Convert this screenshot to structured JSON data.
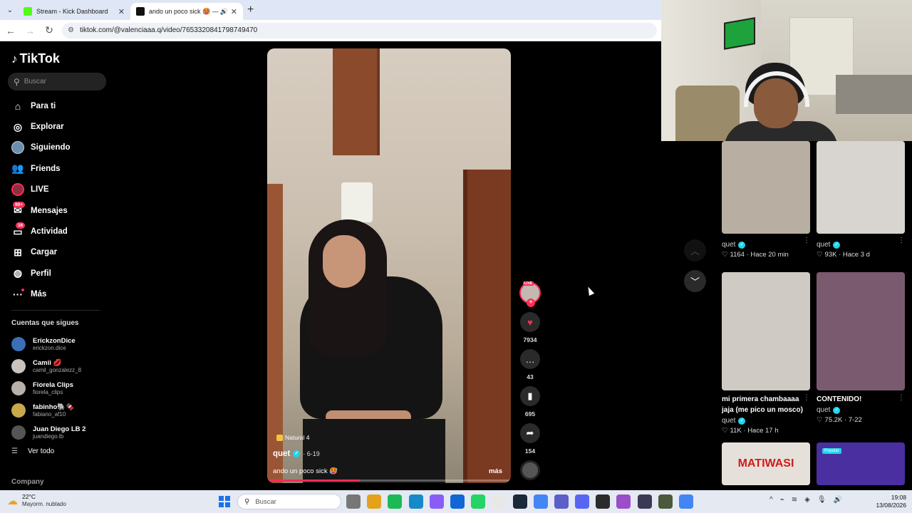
{
  "browser": {
    "tabs": [
      {
        "title": "Stream - Kick Dashboard",
        "favicon_color": "#53fc18",
        "active": false
      },
      {
        "title": "ando un poco sick 🥵 — q",
        "favicon_color": "#111111",
        "active": true
      }
    ],
    "url": "tiktok.com/@valenciaaa.q/video/7653320841798749470"
  },
  "sidebar": {
    "logo": "TikTok",
    "search_placeholder": "Buscar",
    "nav": [
      {
        "label": "Para ti",
        "icon": "home-icon",
        "glyph": "⌂"
      },
      {
        "label": "Explorar",
        "icon": "compass-icon",
        "glyph": "◎"
      },
      {
        "label": "Siguiendo",
        "icon": "following-avatar",
        "glyph": ""
      },
      {
        "label": "Friends",
        "icon": "friends-icon",
        "glyph": "👥"
      },
      {
        "label": "LIVE",
        "icon": "live-avatar",
        "glyph": ""
      },
      {
        "label": "Mensajes",
        "icon": "messages-icon",
        "glyph": "✉",
        "badge": "99+"
      },
      {
        "label": "Actividad",
        "icon": "activity-icon",
        "glyph": "▭",
        "badge": "16"
      },
      {
        "label": "Cargar",
        "icon": "upload-icon",
        "glyph": "⊞"
      },
      {
        "label": "Perfil",
        "icon": "profile-avatar",
        "glyph": "◍"
      },
      {
        "label": "Más",
        "icon": "more-icon",
        "glyph": "···"
      }
    ],
    "following_title": "Cuentas que sigues",
    "following": [
      {
        "name": "ErickzonDice",
        "handle": "erickzon.dice",
        "color": "#3b6fb6"
      },
      {
        "name": "Camii 💋",
        "handle": "camil_gonzalezz_8",
        "color": "#c9c2bd"
      },
      {
        "name": "Fiorela Clips",
        "handle": "fiorela_clips",
        "color": "#b8b0aa"
      },
      {
        "name": "fabinho🐘🍫",
        "handle": "fabiano_af10",
        "color": "#c8a84a"
      },
      {
        "name": "Juan Diego LB 2",
        "handle": "juandiego.lb",
        "color": "#555555"
      }
    ],
    "see_all": "Ver todo",
    "company": "Company"
  },
  "video": {
    "label": "Natural 4",
    "author": "quet",
    "date": "· 6-19",
    "caption": "ando un poco sick 🥵",
    "more": "más",
    "progress": 0.38,
    "likes": "7934",
    "comments": "43",
    "saves": "695",
    "shares": "154",
    "live_tag": "LIVE"
  },
  "recommended": [
    {
      "title": "",
      "author": "quet",
      "likes": "1164",
      "time": "Hace 20 min",
      "bg": "#b9aea2"
    },
    {
      "title": "",
      "author": "quet",
      "likes": "93K",
      "time": "Hace 3 d",
      "bg": "#d8d4cf"
    },
    {
      "title": "mi primera chambaaaa jaja (me pico un mosco)",
      "author": "quet",
      "likes": "11K",
      "time": "Hace 17 h",
      "bg": "#cfcac3"
    },
    {
      "title": "CONTENIDO!",
      "author": "quet",
      "likes": "75.2K",
      "time": "7-22",
      "bg": "#7a5a6e"
    },
    {
      "title": "MATIWASI",
      "author": "",
      "likes": "",
      "time": "",
      "bg": "#e6e0da"
    },
    {
      "title": "Popular",
      "author": "",
      "likes": "",
      "time": "",
      "bg": "#4a2fa0"
    }
  ],
  "taskbar": {
    "temp": "22°C",
    "weather": "Mayorm. nublado",
    "search_placeholder": "Buscar",
    "time": "19:08",
    "date": "13/08/2026",
    "app_colors": [
      "#777777",
      "#e3a21a",
      "#1db954",
      "#1689c7",
      "#8a5cf6",
      "#1066d6",
      "#25d366",
      "#e8e8e8",
      "#1b2838",
      "#4285f4",
      "#5b5fc7",
      "#5865f2",
      "#2b2b2b",
      "#9b4dca",
      "#3a3a55",
      "#4a5a3a",
      "#4285f4"
    ]
  }
}
